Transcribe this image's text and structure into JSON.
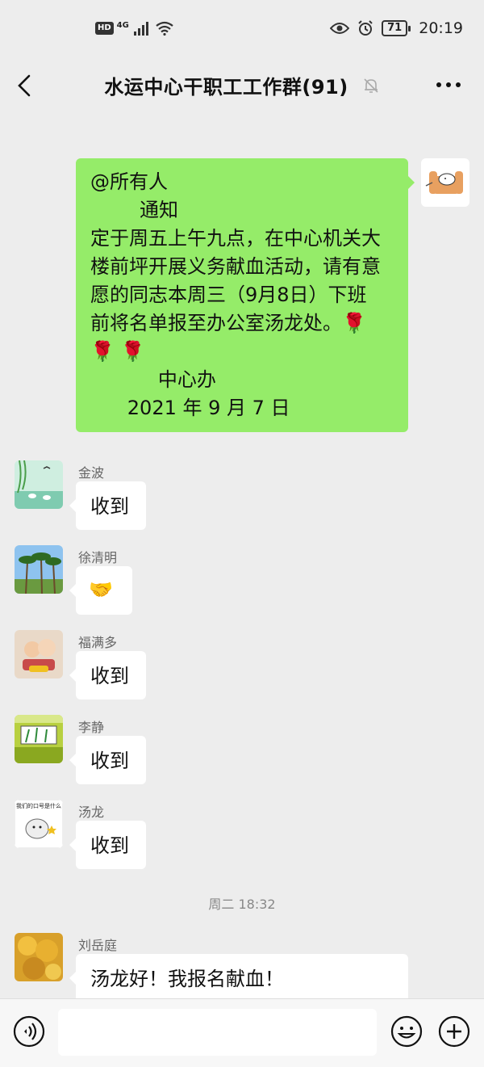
{
  "status_bar": {
    "hd": "HD",
    "network": "4G",
    "battery": "71",
    "time": "20:19"
  },
  "header": {
    "title": "水运中心干职工工作群(91)",
    "back_icon": "chevron-left-icon",
    "mute_icon": "bell-off-icon",
    "more_icon": "more-dots-icon"
  },
  "messages": {
    "m0": {
      "lines": [
        "@所有人",
        "        通知",
        "定于周五上午九点，在中心机关大",
        "楼前坪开展义务献血活动，请有意",
        "愿的同志本周三（9月8日）下班",
        "前将名单报至办公室汤龙处。🌹",
        "🌹 🌹",
        "           中心办",
        "      2021 年 9 月 7 日"
      ]
    },
    "m1": {
      "name": "金波",
      "text": "收到"
    },
    "m2": {
      "name": "徐清明",
      "text": "🤝"
    },
    "m3": {
      "name": "福满多",
      "text": "收到"
    },
    "m4": {
      "name": "李静",
      "text": "收到",
      "avatar_caption": ""
    },
    "m5": {
      "name": "汤龙",
      "text": "收到",
      "avatar_caption": "我们的口号是什么"
    },
    "ts": "周二 18:32",
    "m6": {
      "name": "刘岳庭",
      "text": "汤龙好！我报名献血！"
    }
  },
  "input_bar": {
    "placeholder": "",
    "voice_icon": "voice-icon",
    "emoji_icon": "emoji-icon",
    "plus_icon": "plus-icon"
  },
  "colors": {
    "background": "#ededed",
    "own_bubble": "#95ec69",
    "other_bubble": "#ffffff"
  }
}
